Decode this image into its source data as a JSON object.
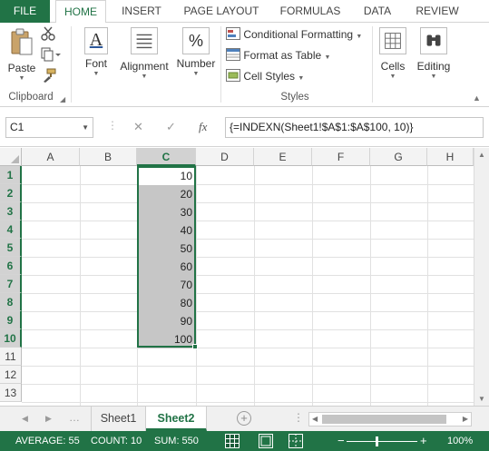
{
  "ribbon_tabs": [
    "FILE",
    "HOME",
    "INSERT",
    "PAGE LAYOUT",
    "FORMULAS",
    "DATA",
    "REVIEW"
  ],
  "active_tab": "HOME",
  "ribbon": {
    "clipboard": {
      "paste_label": "Paste",
      "group_label": "Clipboard"
    },
    "font": {
      "label": "Font",
      "icon": "A"
    },
    "alignment": {
      "label": "Alignment"
    },
    "number": {
      "label": "Number",
      "icon": "%"
    },
    "styles": {
      "conditional_formatting": "Conditional Formatting",
      "format_as_table": "Format as Table",
      "cell_styles": "Cell Styles",
      "group_label": "Styles"
    },
    "cells": {
      "label": "Cells"
    },
    "editing": {
      "label": "Editing"
    }
  },
  "formula_bar": {
    "name_box": "C1",
    "cancel_glyph": "✕",
    "enter_glyph": "✓",
    "fx_label": "fx",
    "formula": "{=INDEXN(Sheet1!$A$1:$A$100, 10)}"
  },
  "columns": [
    "A",
    "B",
    "C",
    "D",
    "E",
    "F",
    "G",
    "H"
  ],
  "selected_column": "C",
  "rows": [
    "1",
    "2",
    "3",
    "4",
    "5",
    "6",
    "7",
    "8",
    "9",
    "10",
    "11",
    "12",
    "13"
  ],
  "cells_c": [
    "10",
    "20",
    "30",
    "40",
    "50",
    "60",
    "70",
    "80",
    "90",
    "100"
  ],
  "sheets": [
    "Sheet1",
    "Sheet2"
  ],
  "active_sheet": "Sheet2",
  "status": {
    "average": "AVERAGE: 55",
    "count": "COUNT: 10",
    "sum": "SUM: 550",
    "zoom": "100%"
  },
  "colors": {
    "accent": "#217346",
    "selection_fill": "#c6c6c6",
    "header_selected": "#d2d2d2"
  }
}
